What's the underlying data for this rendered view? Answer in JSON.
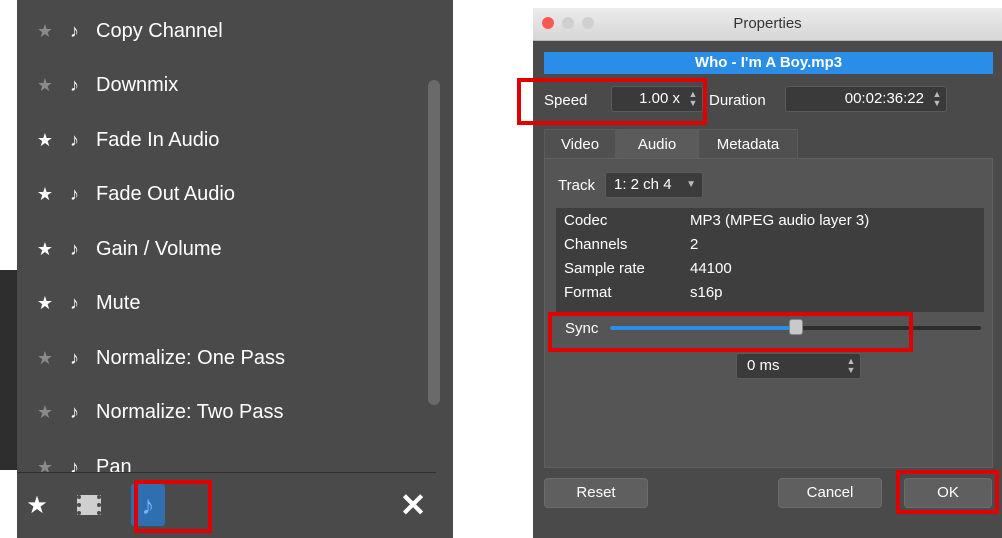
{
  "filters": [
    {
      "label": "Copy Channel",
      "favorite": false
    },
    {
      "label": "Downmix",
      "favorite": false
    },
    {
      "label": "Fade In Audio",
      "favorite": true
    },
    {
      "label": "Fade Out Audio",
      "favorite": true
    },
    {
      "label": "Gain / Volume",
      "favorite": true
    },
    {
      "label": "Mute",
      "favorite": true
    },
    {
      "label": "Normalize: One Pass",
      "favorite": false
    },
    {
      "label": "Normalize: Two Pass",
      "favorite": false
    },
    {
      "label": "Pan",
      "favorite": false
    }
  ],
  "toolbar": {
    "favorites_icon": "star-icon",
    "video_icon": "film-icon",
    "audio_icon": "music-note-icon",
    "close_icon": "close-icon",
    "audio_selected": true
  },
  "dialog": {
    "title": "Properties",
    "file_name": "Who - I'm A Boy.mp3",
    "speed_label": "Speed",
    "speed_value": "1.00 x",
    "duration_label": "Duration",
    "duration_value": "00:02:36:22",
    "tabs": [
      {
        "label": "Video",
        "active": false
      },
      {
        "label": "Audio",
        "active": true
      },
      {
        "label": "Metadata",
        "active": false
      }
    ],
    "track_label": "Track",
    "track_value": "1: 2 ch 4",
    "info": [
      {
        "key": "Codec",
        "value": "MP3 (MPEG audio layer 3)"
      },
      {
        "key": "Channels",
        "value": "2"
      },
      {
        "key": "Sample rate",
        "value": "44100"
      },
      {
        "key": "Format",
        "value": "s16p"
      }
    ],
    "sync_label": "Sync",
    "sync_fraction": 0.5,
    "sync_value": "0 ms",
    "reset_label": "Reset",
    "cancel_label": "Cancel",
    "ok_label": "OK"
  },
  "colors": {
    "panel_bg": "#4a4a4a",
    "accent": "#2a8ee8",
    "highlight": "#e00000"
  }
}
